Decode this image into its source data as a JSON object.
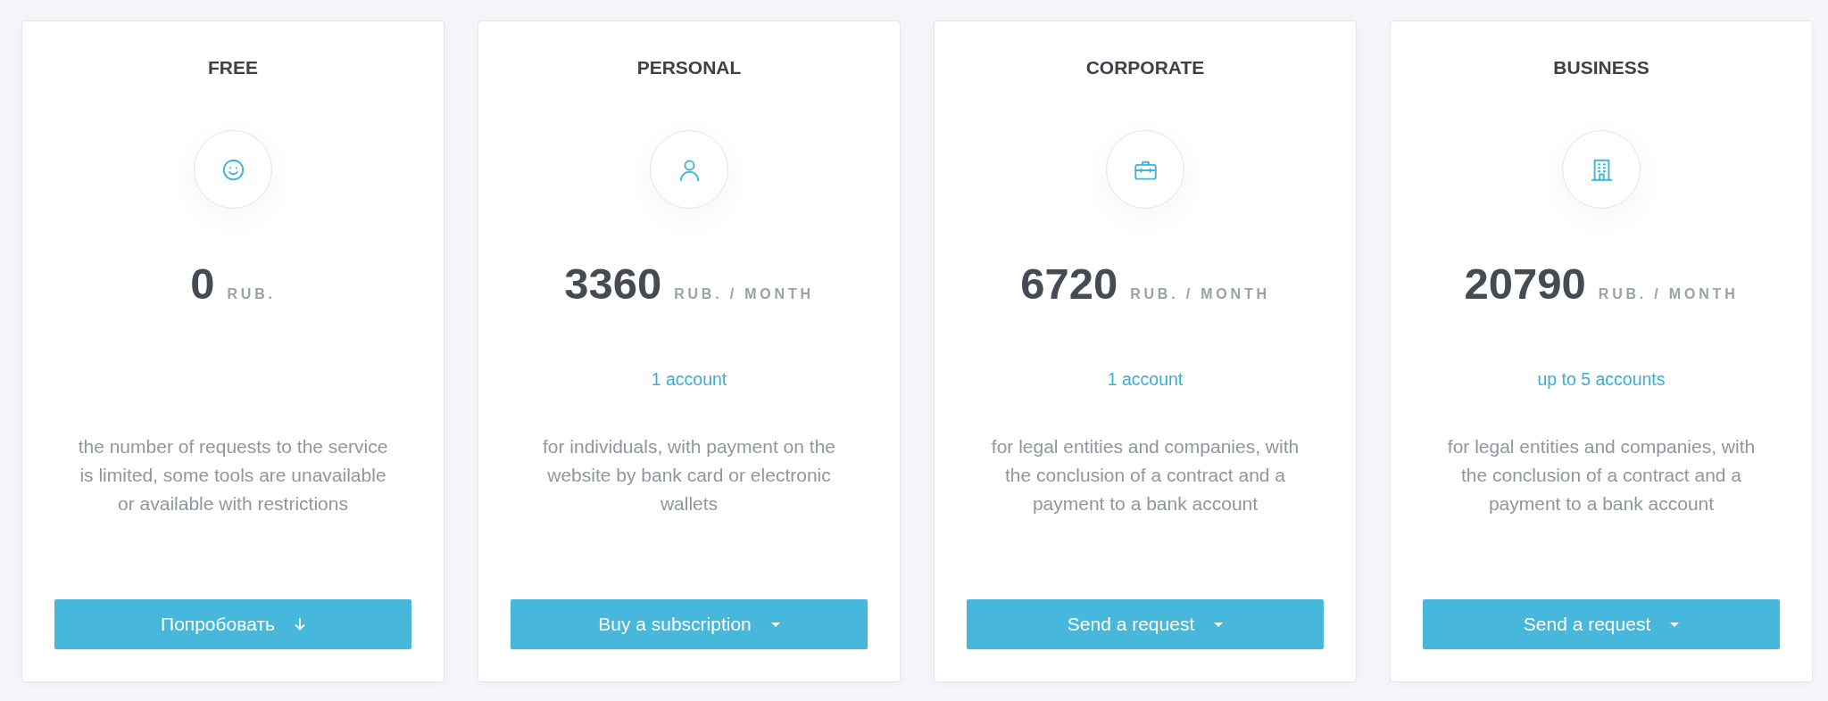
{
  "plans": [
    {
      "title": "FREE",
      "kind": "smiley",
      "price": {
        "amount": "0",
        "unit": "RUB."
      },
      "description": "the number of requests to the service is limited, some tools are unavailable or available with restrictions",
      "button": {
        "label": "Попробовать",
        "kind": "arrow"
      }
    },
    {
      "title": "PERSONAL",
      "kind": "person",
      "price": {
        "amount": "3360",
        "unit": "RUB. / MONTH"
      },
      "accounts": "1 account",
      "description": "for individuals, with payment on the website by bank card or electronic wallets",
      "button": {
        "label": "Buy a subscription",
        "kind": "caret"
      }
    },
    {
      "title": "CORPORATE",
      "kind": "briefcase",
      "price": {
        "amount": "6720",
        "unit": "RUB. / MONTH"
      },
      "accounts": "1 account",
      "description": "for legal entities and companies, with the conclusion of a contract and a payment to a bank account",
      "button": {
        "label": "Send a request",
        "kind": "caret"
      }
    },
    {
      "title": "BUSINESS",
      "kind": "building",
      "price": {
        "amount": "20790",
        "unit": "RUB. / MONTH"
      },
      "accounts": "up to 5 accounts",
      "description": "for legal entities and companies, with the conclusion of a contract and a payment to a bank account",
      "button": {
        "label": "Send a request",
        "kind": "caret"
      }
    }
  ]
}
